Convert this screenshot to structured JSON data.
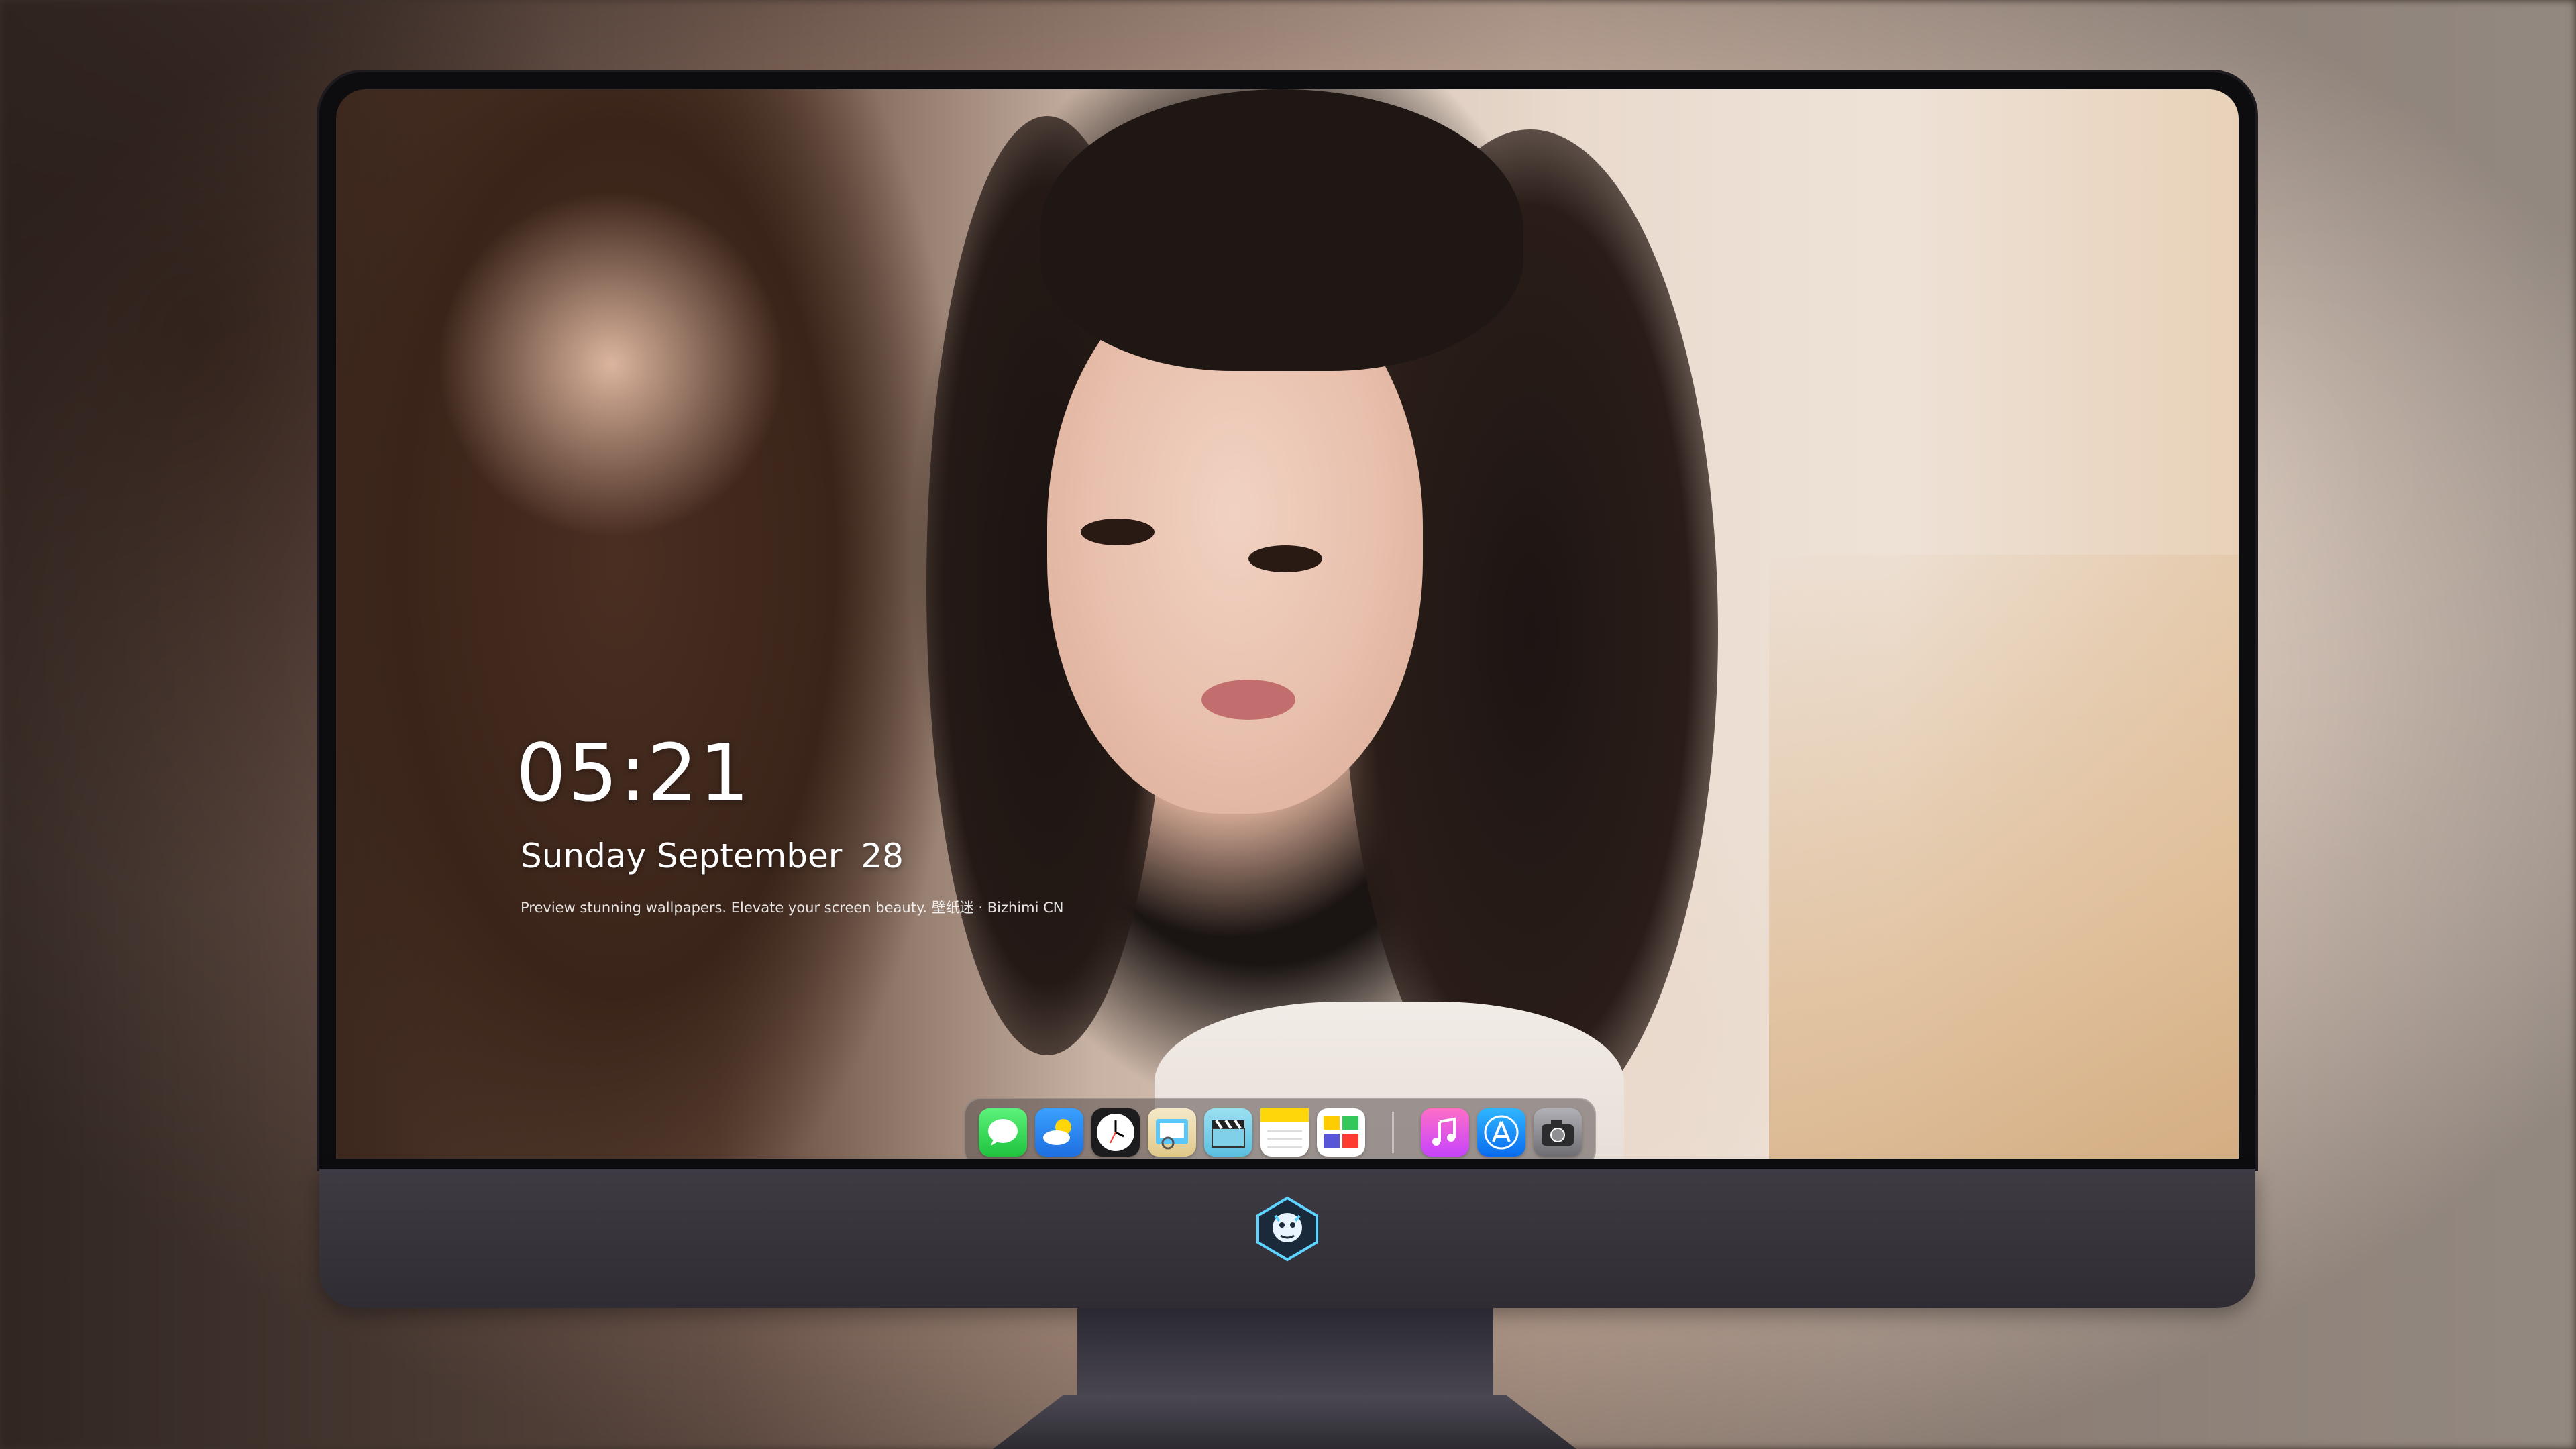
{
  "lockscreen": {
    "time": "05:21",
    "weekday_month": "Sunday September",
    "day": "28",
    "tagline": "Preview stunning wallpapers. Elevate your screen beauty. 壁纸迷 · Bizhimi CN"
  },
  "dock": {
    "apps": [
      {
        "name": "messages-icon",
        "color": "#34c759"
      },
      {
        "name": "weather-icon",
        "color": "#1e90ff"
      },
      {
        "name": "clock-icon",
        "color": "#1c1c1e"
      },
      {
        "name": "preview-icon",
        "color": "#5ac8fa"
      },
      {
        "name": "claquette-icon",
        "color": "#7fd0e8"
      },
      {
        "name": "notes-icon",
        "color": "#ffd60a"
      },
      {
        "name": "photo-gallery-icon",
        "color": "#ffffff"
      },
      {
        "name": "music-icon",
        "color": "#fc3c9e"
      },
      {
        "name": "app-store-icon",
        "color": "#1a8cff"
      },
      {
        "name": "camera-icon",
        "color": "#8e8e93"
      }
    ]
  },
  "monitor": {
    "logo": "dragon-logo-icon"
  }
}
